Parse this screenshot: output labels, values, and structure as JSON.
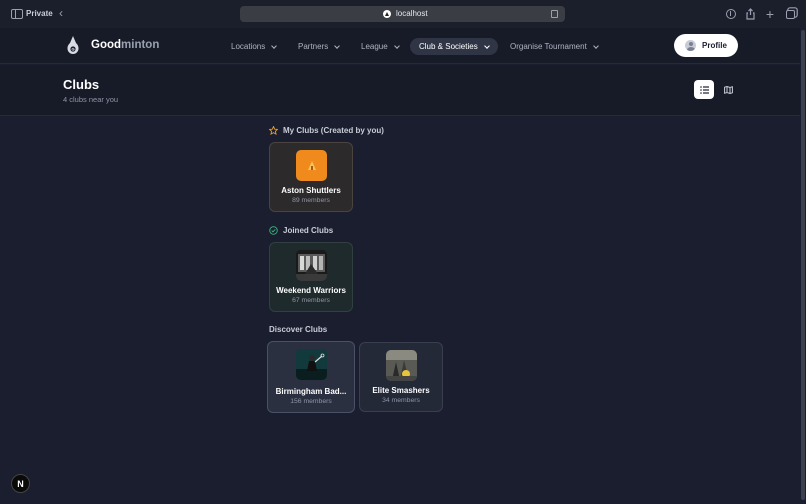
{
  "browser": {
    "private_label": "Private",
    "url": "localhost"
  },
  "app": {
    "brand_a": "Good",
    "brand_b": "minton",
    "nav": [
      {
        "label": "Locations"
      },
      {
        "label": "Partners"
      },
      {
        "label": "League"
      },
      {
        "label": "Club & Societies",
        "active": true
      },
      {
        "label": "Organise Tournament"
      }
    ],
    "profile_label": "Profile"
  },
  "page": {
    "title": "Clubs",
    "subtitle": "4 clubs near you"
  },
  "sections": {
    "mine": {
      "title": "My Clubs (Created by you)",
      "clubs": [
        {
          "name": "Aston Shuttlers",
          "members": "89 members"
        }
      ]
    },
    "joined": {
      "title": "Joined Clubs",
      "clubs": [
        {
          "name": "Weekend Warriors",
          "members": "67 members"
        }
      ]
    },
    "discover": {
      "title": "Discover Clubs",
      "clubs": [
        {
          "name": "Birmingham Bad...",
          "members": "156 members"
        },
        {
          "name": "Elite Smashers",
          "members": "34 members"
        }
      ]
    }
  },
  "icons": {
    "star": "star-icon",
    "check": "check-circle-icon",
    "list": "list-icon",
    "map": "map-icon"
  },
  "colors": {
    "background": "#1a1e2e",
    "star_accent": "#e0a03a",
    "check_accent": "#3fb37f",
    "aston_thumb": "#f08a1c"
  },
  "nextjs_badge": "N"
}
